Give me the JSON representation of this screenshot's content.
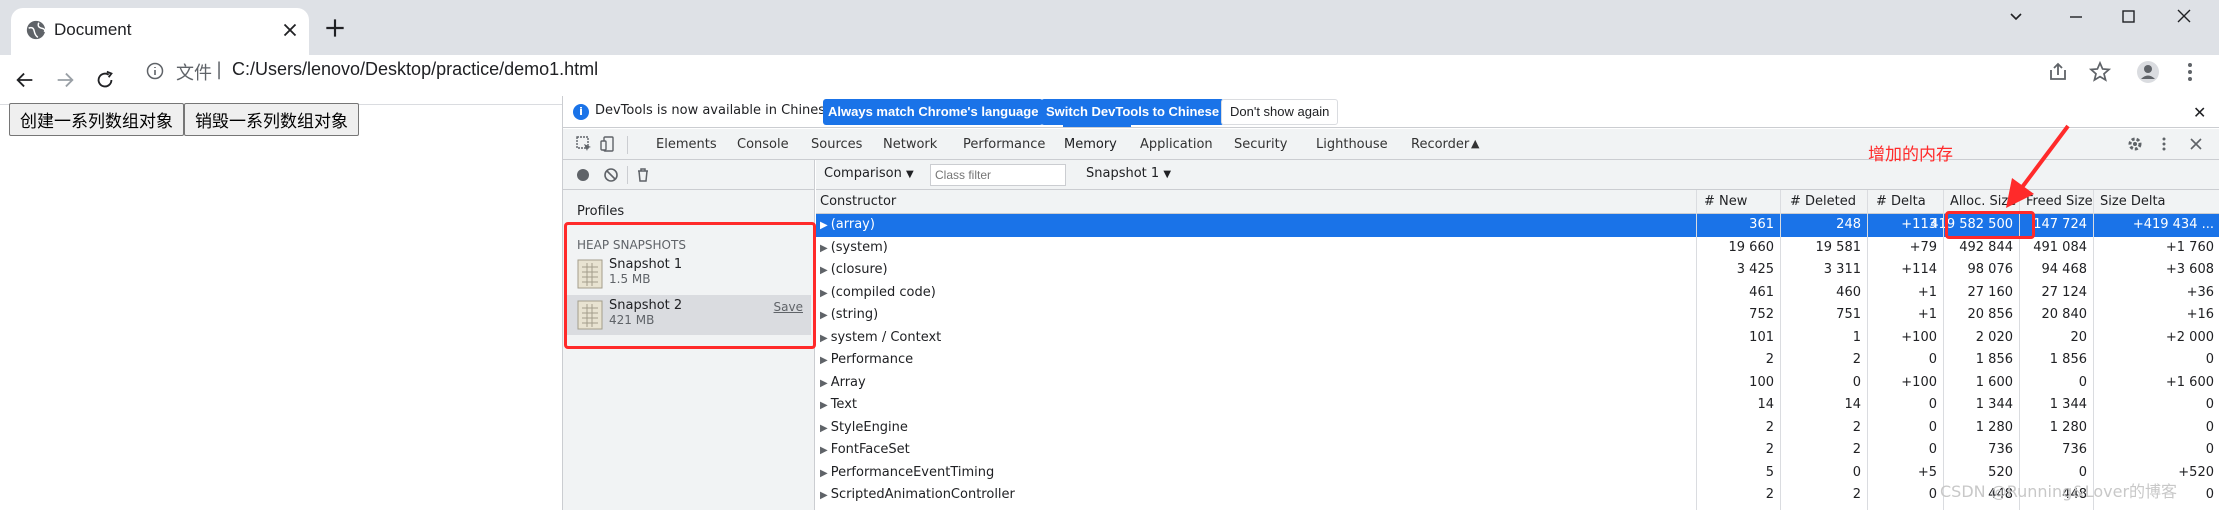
{
  "browser": {
    "tab_title": "Document",
    "url_scheme": "文件",
    "url_separator": "|",
    "url": "C:/Users/lenovo/Desktop/practice/demo1.html"
  },
  "page": {
    "buttons": [
      "创建一系列数组对象",
      "销毁一系列数组对象"
    ]
  },
  "devtools": {
    "info_bar": {
      "message": "DevTools is now available in Chinese!",
      "match_button": "Always match Chrome's language",
      "switch_button": "Switch DevTools to Chinese",
      "dismiss_button": "Don't show again"
    },
    "tabs": [
      "Elements",
      "Console",
      "Sources",
      "Network",
      "Performance",
      "Memory",
      "Application",
      "Security",
      "Lighthouse",
      "Recorder"
    ],
    "active_tab": "Memory",
    "sidebar": {
      "profiles_label": "Profiles",
      "heap_label": "HEAP SNAPSHOTS",
      "snapshots": [
        {
          "name": "Snapshot 1",
          "size": "1.5 MB"
        },
        {
          "name": "Snapshot 2",
          "size": "421 MB",
          "save": "Save"
        }
      ]
    },
    "toolbar": {
      "view_select": "Comparison",
      "class_filter_placeholder": "Class filter",
      "base_select": "Snapshot 1"
    },
    "table": {
      "headers": [
        "Constructor",
        "# New",
        "# Deleted",
        "# Delta",
        "Alloc. Size",
        "Freed Size",
        "Size Delta"
      ],
      "rows": [
        {
          "name": "(array)",
          "new": "361",
          "deleted": "248",
          "delta": "+113",
          "alloc": "419 582 500",
          "freed": "147 724",
          "size_delta": "+419 434 ..."
        },
        {
          "name": "(system)",
          "new": "19 660",
          "deleted": "19 581",
          "delta": "+79",
          "alloc": "492 844",
          "freed": "491 084",
          "size_delta": "+1 760"
        },
        {
          "name": "(closure)",
          "new": "3 425",
          "deleted": "3 311",
          "delta": "+114",
          "alloc": "98 076",
          "freed": "94 468",
          "size_delta": "+3 608"
        },
        {
          "name": "(compiled code)",
          "new": "461",
          "deleted": "460",
          "delta": "+1",
          "alloc": "27 160",
          "freed": "27 124",
          "size_delta": "+36"
        },
        {
          "name": "(string)",
          "new": "752",
          "deleted": "751",
          "delta": "+1",
          "alloc": "20 856",
          "freed": "20 840",
          "size_delta": "+16"
        },
        {
          "name": "system / Context",
          "new": "101",
          "deleted": "1",
          "delta": "+100",
          "alloc": "2 020",
          "freed": "20",
          "size_delta": "+2 000"
        },
        {
          "name": "Performance",
          "new": "2",
          "deleted": "2",
          "delta": "0",
          "alloc": "1 856",
          "freed": "1 856",
          "size_delta": "0"
        },
        {
          "name": "Array",
          "new": "100",
          "deleted": "0",
          "delta": "+100",
          "alloc": "1 600",
          "freed": "0",
          "size_delta": "+1 600"
        },
        {
          "name": "Text",
          "new": "14",
          "deleted": "14",
          "delta": "0",
          "alloc": "1 344",
          "freed": "1 344",
          "size_delta": "0"
        },
        {
          "name": "StyleEngine",
          "new": "2",
          "deleted": "2",
          "delta": "0",
          "alloc": "1 280",
          "freed": "1 280",
          "size_delta": "0"
        },
        {
          "name": "FontFaceSet",
          "new": "2",
          "deleted": "2",
          "delta": "0",
          "alloc": "736",
          "freed": "736",
          "size_delta": "0"
        },
        {
          "name": "PerformanceEventTiming",
          "new": "5",
          "deleted": "0",
          "delta": "+5",
          "alloc": "520",
          "freed": "0",
          "size_delta": "+520"
        },
        {
          "name": "ScriptedAnimationController",
          "new": "2",
          "deleted": "2",
          "delta": "0",
          "alloc": "448",
          "freed": "448",
          "size_delta": "0"
        }
      ]
    }
  },
  "annotation": {
    "label": "增加的内存",
    "color": "#ff2a2a"
  },
  "watermark": "CSDN @Running&Lover的博客"
}
